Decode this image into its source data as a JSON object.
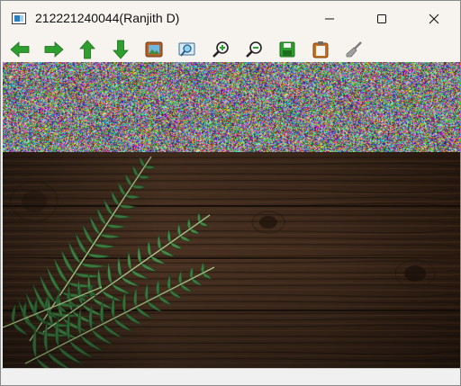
{
  "window": {
    "title": "212221240044(Ranjith D)"
  },
  "titlebar_buttons": {
    "minimize": "minimize-icon",
    "maximize": "maximize-icon",
    "close": "close-icon"
  },
  "toolbar": {
    "items": [
      {
        "name": "previous",
        "icon": "arrow-left-icon",
        "color": "#2e9e2e"
      },
      {
        "name": "next",
        "icon": "arrow-right-icon",
        "color": "#2e9e2e"
      },
      {
        "name": "up",
        "icon": "arrow-up-icon",
        "color": "#2e9e2e"
      },
      {
        "name": "down",
        "icon": "arrow-down-icon",
        "color": "#2e9e2e"
      },
      {
        "name": "image",
        "icon": "image-icon",
        "color": "#b0602a"
      },
      {
        "name": "zoom-fit",
        "icon": "zoom-fit-icon",
        "color": "#3a8fd0"
      },
      {
        "name": "zoom-in",
        "icon": "zoom-in-icon",
        "color": "#2e9e2e"
      },
      {
        "name": "zoom-out",
        "icon": "zoom-out-icon",
        "color": "#2e9e2e"
      },
      {
        "name": "save",
        "icon": "save-icon",
        "color": "#2e9e2e"
      },
      {
        "name": "clipboard",
        "icon": "clipboard-icon",
        "color": "#c8701e"
      },
      {
        "name": "clear",
        "icon": "brush-icon",
        "color": "#8a8a8a"
      }
    ]
  },
  "canvas": {
    "top_region": "random-noise",
    "bottom_region": "fern-on-wood-photo"
  }
}
